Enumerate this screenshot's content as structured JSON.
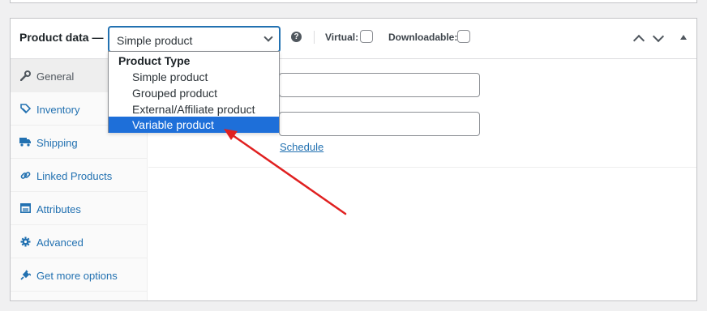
{
  "header": {
    "title": "Product data —",
    "product_type": {
      "selected": "Simple product",
      "icon": "chevron-down-icon"
    },
    "help_icon": "?",
    "virtual_label": "Virtual:",
    "downloadable_label": "Downloadable:"
  },
  "dropdown": {
    "group_label": "Product Type",
    "options": [
      "Simple product",
      "Grouped product",
      "External/Affiliate product",
      "Variable product"
    ],
    "highlighted": "Variable product"
  },
  "sidebar": {
    "items": [
      {
        "label": "General",
        "icon": "wrench-icon"
      },
      {
        "label": "Inventory",
        "icon": "tag-icon"
      },
      {
        "label": "Shipping",
        "icon": "truck-icon"
      },
      {
        "label": "Linked Products",
        "icon": "link-icon"
      },
      {
        "label": "Attributes",
        "icon": "list-icon"
      },
      {
        "label": "Advanced",
        "icon": "gear-icon"
      },
      {
        "label": "Get more options",
        "icon": "plugin-icon"
      }
    ]
  },
  "main": {
    "schedule_link": "Schedule"
  },
  "colors": {
    "accent": "#2271b1",
    "highlight": "#1e6fd9",
    "annotation_arrow": "#e02020"
  }
}
